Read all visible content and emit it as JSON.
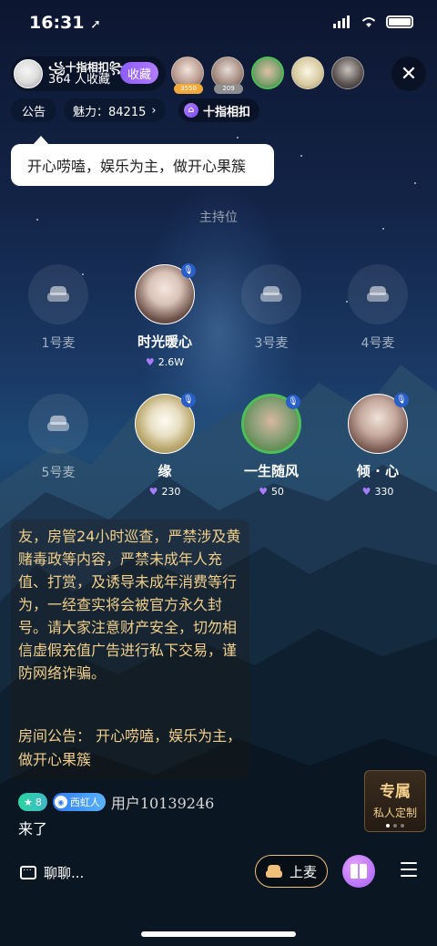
{
  "status_bar": {
    "time": "16:31"
  },
  "room": {
    "name": "꧁十指相扣꧂",
    "fav_count": "364 人收藏",
    "fav_button": "收藏",
    "tag_name": "十指相扣"
  },
  "top_users": [
    {
      "badge": "3550",
      "badge_color": "#f1a93a"
    },
    {
      "badge": "209",
      "badge_color": "#8e8e8e"
    },
    {
      "badge": "",
      "badge_color": ""
    },
    {
      "badge": "",
      "badge_color": ""
    },
    {
      "badge": "",
      "badge_color": ""
    }
  ],
  "tabs": {
    "announce": "公告",
    "charm": "魅力：84215"
  },
  "tooltip": "开心唠嗑，娱乐为主，做开心果簇",
  "host_label": "主持位",
  "seats": [
    {
      "label": "1号麦",
      "filled": false
    },
    {
      "name": "时光暖心",
      "hearts": "2.6W",
      "filled": true
    },
    {
      "label": "3号麦",
      "filled": false
    },
    {
      "label": "4号麦",
      "filled": false
    },
    {
      "label": "5号麦",
      "filled": false
    },
    {
      "name": "缘",
      "hearts": "230",
      "filled": true
    },
    {
      "name": "一生随风",
      "hearts": "50",
      "filled": true
    },
    {
      "name": "倾 · 心",
      "hearts": "330",
      "filled": true
    }
  ],
  "chat": {
    "notice": "友，房管24小时巡查，严禁涉及黄赌毒政等内容，严禁未成年人充值、打赏，及诱导未成年消费等行为，一经查实将会被官方永久封号。请大家注意财产安全，切勿相信虚假充值广告进行私下交易，谨防网络诈骗。",
    "announcement": "房间公告： 开心唠嗑，娱乐为主，做开心果簇",
    "user_level": "8",
    "user_fan_badge": "西虹人",
    "user_name": "用户10139246",
    "message": "来了"
  },
  "promo": {
    "title": "专属",
    "subtitle": "私人定制"
  },
  "bottom_bar": {
    "chat_placeholder": "聊聊...",
    "mic_up": "上麦"
  },
  "colors": {
    "accent_purple": "#8d5cf6",
    "notice_gold": "#f1cf8b",
    "speaking_green": "#4bbf58"
  }
}
